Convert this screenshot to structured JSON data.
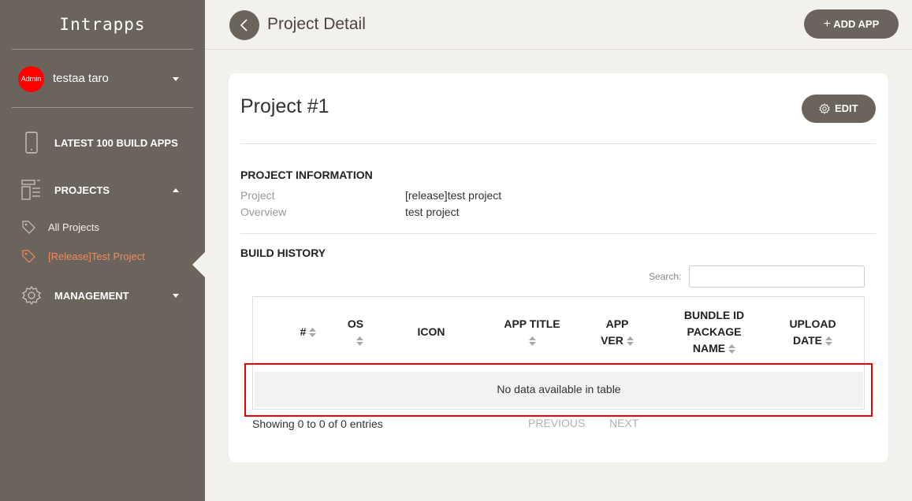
{
  "app": {
    "brand": "Intrapps"
  },
  "user": {
    "badge": "Admin",
    "name": "testaa taro"
  },
  "sidebar": {
    "latest": "LATEST 100 BUILD APPS",
    "projects": "PROJECTS",
    "sub_items": [
      {
        "label": "All Projects",
        "active": false
      },
      {
        "label": "[Release]Test Project",
        "active": true
      }
    ],
    "management": "MANAGEMENT"
  },
  "header": {
    "title": "Project Detail",
    "add_app": "ADD APP",
    "add_icon": "plus-icon"
  },
  "card": {
    "title": "Project #1",
    "edit": "EDIT",
    "info_heading": "PROJECT INFORMATION",
    "info": [
      {
        "key": "Project",
        "value": "[release]test project"
      },
      {
        "key": "Overview",
        "value": "test project"
      }
    ],
    "history_heading": "BUILD HISTORY",
    "search_label": "Search:",
    "search_value": "",
    "columns": {
      "num": "#",
      "os": "OS",
      "icon": "ICON",
      "app_title": "APP TITLE",
      "app_ver_1": "APP",
      "app_ver_2": "VER",
      "bundle_1": "BUNDLE ID",
      "bundle_2": "PACKAGE",
      "bundle_3": "NAME",
      "upload_1": "UPLOAD",
      "upload_2": "DATE"
    },
    "empty_message": "No data available in table",
    "showing": "Showing 0 to 0 of 0 entries",
    "previous": "PREVIOUS",
    "next": "NEXT"
  },
  "colors": {
    "sidebar": "#6b645c",
    "accent": "#f08a5d",
    "avatar": "#ff0000",
    "highlight": "#e00000"
  }
}
